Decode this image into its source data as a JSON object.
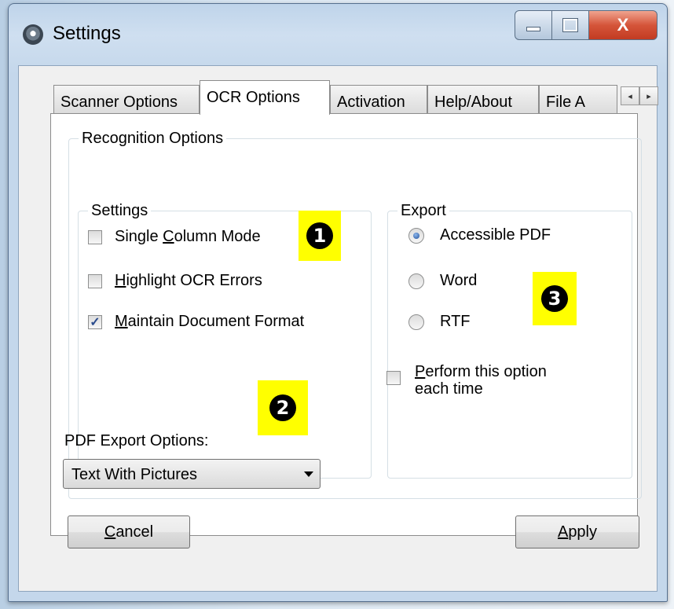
{
  "window": {
    "title": "Settings",
    "caption": {
      "minimize": "–",
      "maximize": "□",
      "close": "X"
    }
  },
  "tabs": [
    {
      "label": "Scanner Options",
      "active": false
    },
    {
      "label": "OCR Options",
      "active": true
    },
    {
      "label": "Activation",
      "active": false
    },
    {
      "label": "Help/About",
      "active": false
    },
    {
      "label": "File A",
      "active": false
    }
  ],
  "tab_scroll": {
    "left": "◂",
    "right": "▸"
  },
  "recognition": {
    "title": "Recognition Options",
    "settings": {
      "title": "Settings",
      "options": [
        {
          "pre": "Single ",
          "key": "C",
          "post": "olumn Mode",
          "checked": false
        },
        {
          "pre": "",
          "key": "H",
          "post": "ighlight OCR Errors",
          "checked": false
        },
        {
          "pre": "",
          "key": "M",
          "post": "aintain Document Format",
          "checked": true
        }
      ],
      "check_mark": "✓",
      "pdf_export_label": "PDF Export Options:",
      "pdf_export_value": "Text With Pictures"
    },
    "export": {
      "title": "Export",
      "options": [
        {
          "label": "Accessible PDF",
          "selected": true
        },
        {
          "label": "Word",
          "selected": false
        },
        {
          "label": "RTF",
          "selected": false
        }
      ],
      "perform": {
        "key": "P",
        "line1_rest": "erform this option",
        "line2": "each time",
        "checked": false
      }
    }
  },
  "badges": [
    "1",
    "2",
    "3"
  ],
  "badge_color": "#ffff00",
  "buttons": {
    "cancel": {
      "key": "C",
      "rest": "ancel"
    },
    "apply": {
      "key": "A",
      "rest": "pply"
    }
  }
}
